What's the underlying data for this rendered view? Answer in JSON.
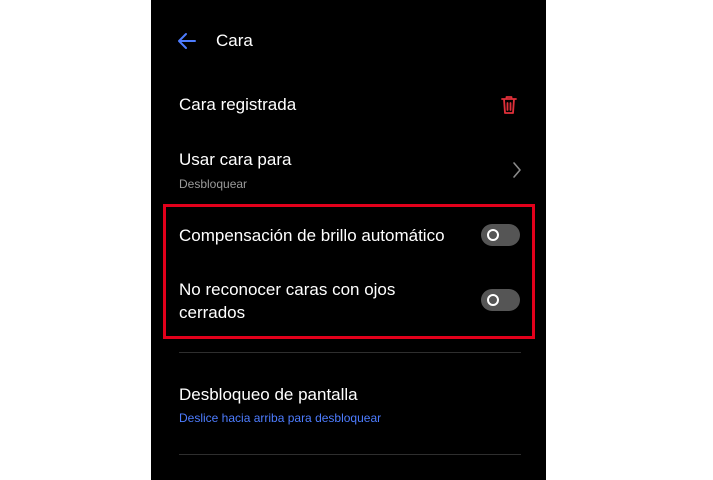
{
  "header": {
    "title": "Cara",
    "back_icon": "arrow-left-icon"
  },
  "rows": {
    "registered": {
      "label": "Cara registrada",
      "icon": "trash-icon",
      "icon_color": "#e0303a"
    },
    "use_face": {
      "label": "Usar cara para",
      "value": "Desbloquear",
      "icon": "chevron-right-icon"
    },
    "brightness": {
      "label": "Compensación de brillo automático",
      "enabled": false
    },
    "closed_eyes": {
      "label_line1": "No reconocer caras con ojos",
      "label_line2": "cerrados",
      "enabled": false
    },
    "unlock": {
      "label": "Desbloqueo de pantalla",
      "value": "Deslice hacia arriba para desbloquear"
    }
  },
  "colors": {
    "background": "#000000",
    "accent": "#4d7cfe",
    "highlight": "#e3001b",
    "danger": "#e0303a"
  }
}
